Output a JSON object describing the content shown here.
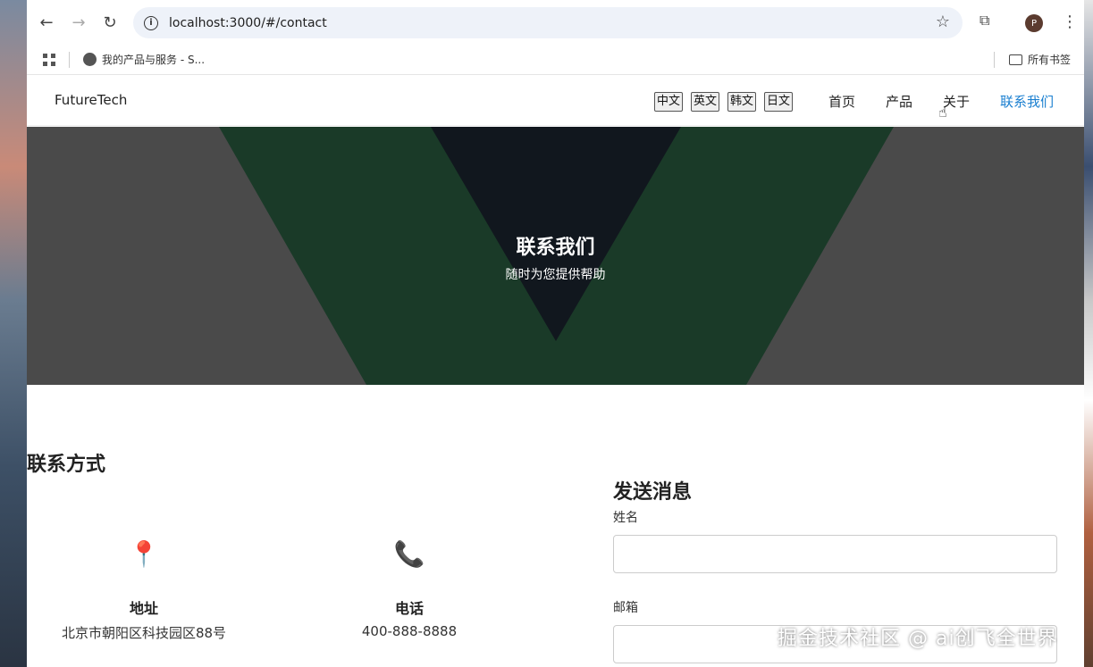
{
  "browser": {
    "url": "localhost:3000/#/contact",
    "bookmark_item": "我的产品与服务 - S...",
    "all_bookmarks": "所有书签",
    "profile_initial": "P"
  },
  "site": {
    "logo": "FutureTech",
    "languages": [
      "中文",
      "英文",
      "韩文",
      "日文"
    ],
    "nav": [
      "首页",
      "产品",
      "关于",
      "联系我们"
    ],
    "active_nav": "联系我们",
    "accent_color": "#1a7fd0"
  },
  "hero": {
    "title": "联系我们",
    "subtitle": "随时为您提供帮助"
  },
  "contact": {
    "heading": "联系方式",
    "cards": [
      {
        "icon": "📍",
        "icon_name": "pin-icon",
        "title": "地址",
        "value": "北京市朝阳区科技园区88号"
      },
      {
        "icon": "📞",
        "icon_name": "phone-icon",
        "title": "电话",
        "value": "400-888-8888"
      }
    ]
  },
  "form": {
    "heading": "发送消息",
    "name_label": "姓名",
    "email_label": "邮箱"
  },
  "watermark": "掘金技术社区 @ ai创飞全世界"
}
